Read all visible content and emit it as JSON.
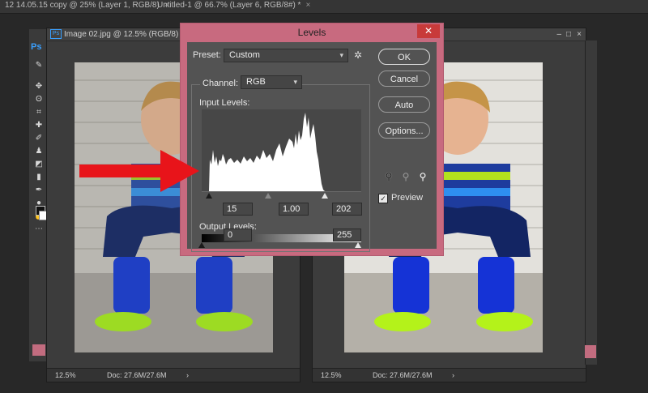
{
  "tabs": [
    {
      "label": "12 14.05.15 copy @ 25% (Layer 1, RGB/8)",
      "close": "×"
    },
    {
      "label": "Untitled-1 @ 66.7% (Layer 6, RGB/8#) *",
      "close": "×"
    }
  ],
  "toolbar": {
    "logo": "Ps",
    "tools": [
      "move-tool",
      "marquee-tool",
      "lasso-tool",
      "crop-tool",
      "eyedropper-tool",
      "healing-brush-tool",
      "brush-tool",
      "clone-stamp-tool",
      "eraser-tool",
      "gradient-tool",
      "pen-tool",
      "text-tool",
      "hand-tool",
      "zoom-tool",
      "more-tools"
    ]
  },
  "left_doc": {
    "title": "Image 02.jpg @ 12.5% (RGB/8)",
    "zoom": "12.5%",
    "doc_info": "Doc: 27.6M/27.6M",
    "nav_arrow": "›"
  },
  "right_doc": {
    "zoom": "12.5%",
    "doc_info": "Doc: 27.6M/27.6M",
    "nav_arrow": "›",
    "controls": [
      "–",
      "□",
      "×"
    ]
  },
  "levels": {
    "title": "Levels",
    "close": "✕",
    "preset_label": "Preset:",
    "preset_value": "Custom",
    "channel_label": "Channel:",
    "channel_value": "RGB",
    "input_label": "Input Levels:",
    "input_black": "15",
    "input_gamma": "1.00",
    "input_white": "202",
    "output_label": "Output Levels:",
    "output_black": "0",
    "output_white": "255",
    "ok_label": "OK",
    "cancel_label": "Cancel",
    "auto_label": "Auto",
    "options_label": "Options...",
    "preview_label": "Preview",
    "preview_checked": true
  },
  "colors": {
    "dialog_border": "#c86a7f",
    "arrow": "#e8141a",
    "accent": "#3aa0ff"
  }
}
